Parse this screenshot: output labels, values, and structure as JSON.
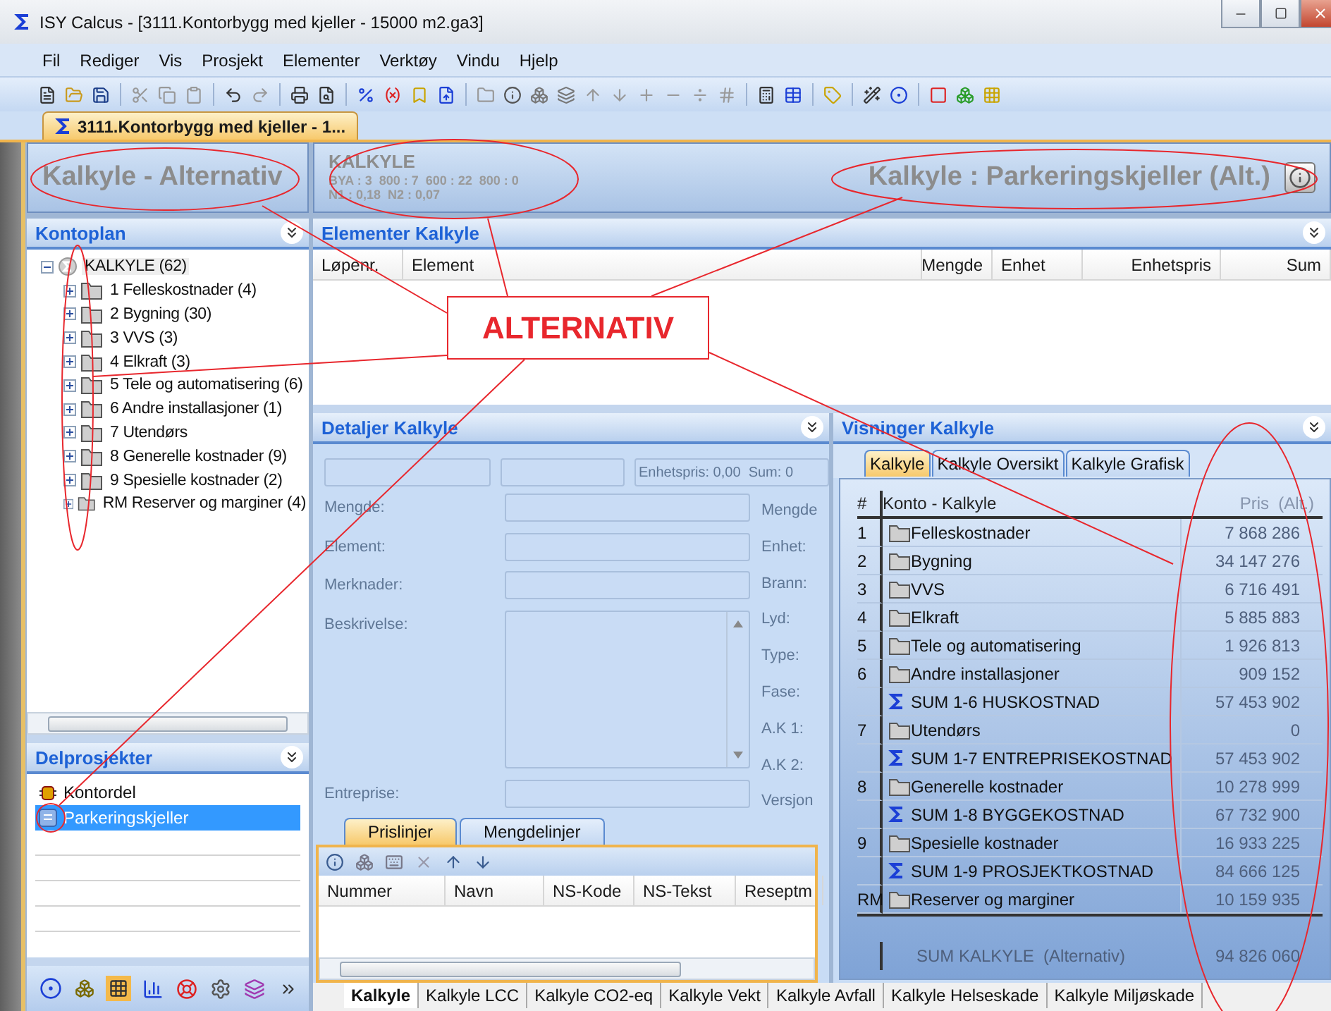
{
  "window": {
    "title": "ISY Calcus - [3111.Kontorbygg med kjeller - 15000 m2.ga3]"
  },
  "menu": [
    {
      "label": "Fil"
    },
    {
      "label": "Rediger"
    },
    {
      "label": "Vis"
    },
    {
      "label": "Prosjekt"
    },
    {
      "label": "Elementer"
    },
    {
      "label": "Verktøy"
    },
    {
      "label": "Vindu"
    },
    {
      "label": "Hjelp"
    }
  ],
  "document_tab": {
    "label": "3111.Kontorbygg med kjeller - 1...",
    "selected": true
  },
  "mode_title": "Kalkyle - Alternativ",
  "kontoplan": {
    "title": "Kontoplan",
    "tree": {
      "label": "KALKYLE (62)",
      "expanded": true,
      "children": [
        {
          "label": "1 Felleskostnader (4)",
          "expanded": false
        },
        {
          "label": "2 Bygning (30)",
          "expanded": false
        },
        {
          "label": "3 VVS (3)",
          "expanded": false
        },
        {
          "label": "4 Elkraft (3)",
          "expanded": false
        },
        {
          "label": "5 Tele og automatisering (6)",
          "expanded": false
        },
        {
          "label": "6 Andre installasjoner (1)",
          "expanded": false
        },
        {
          "label": "7 Utendørs",
          "expanded": false
        },
        {
          "label": "8 Generelle kostnader (9)",
          "expanded": false
        },
        {
          "label": "9 Spesielle kostnader (2)",
          "expanded": false
        },
        {
          "label": "RM Reserver og marginer (4)",
          "expanded": false
        }
      ]
    }
  },
  "delprosjekter": {
    "title": "Delprosjekter",
    "items": [
      {
        "label": "Kontordel",
        "kind": "box",
        "selected": false
      },
      {
        "label": "Parkeringskjeller",
        "kind": "page",
        "selected": true
      }
    ]
  },
  "summary": {
    "heading": "KALKYLE",
    "line_1": "BYA : 3  800 : 7  600 : 22  800 : 0",
    "line_2": "N1 : 0,18  N2 : 0,07",
    "title": "Kalkyle : Parkeringskjeller (Alt.)"
  },
  "elementer": {
    "title": "Elementer Kalkyle",
    "columns": [
      {
        "label": "Løpenr."
      },
      {
        "label": "Element"
      },
      {
        "label": "Mengde"
      },
      {
        "label": "Enhet"
      },
      {
        "label": "Enhetspris"
      },
      {
        "label": "Sum"
      }
    ]
  },
  "detaljer": {
    "title": "Detaljer Kalkyle",
    "disabled": true,
    "totals": "Enhetspris: 0,00  Sum: 0",
    "left_labels": [
      "Mengde:",
      "Element:",
      "Merknader:",
      "Beskrivelse:",
      "Entreprise:"
    ],
    "right_labels": [
      "Mengde",
      "Enhet:",
      "Brann:",
      "Lyd:",
      "Type:",
      "Fase:",
      "A.K 1:",
      "A.K 2:",
      "Versjon"
    ],
    "subtabs": [
      {
        "label": "Prislinjer",
        "selected": true
      },
      {
        "label": "Mengdelinjer",
        "selected": false
      }
    ],
    "columns": [
      "Nummer",
      "Navn",
      "NS-Kode",
      "NS-Tekst",
      "Reseptm"
    ]
  },
  "visninger": {
    "title": "Visninger Kalkyle",
    "tabs": [
      {
        "label": "Kalkyle",
        "selected": true
      },
      {
        "label": "Kalkyle Oversikt",
        "selected": false
      },
      {
        "label": "Kalkyle Grafisk",
        "selected": false
      }
    ],
    "columns": [
      "#",
      "Konto - Kalkyle",
      "Pris  (Alt.)"
    ],
    "rows": [
      {
        "number": "1",
        "kind": "folder",
        "label": "Felleskostnader",
        "price": "7 868 286"
      },
      {
        "number": "2",
        "kind": "folder",
        "label": "Bygning",
        "price": "34 147 276"
      },
      {
        "number": "3",
        "kind": "folder",
        "label": "VVS",
        "price": "6 716 491"
      },
      {
        "number": "4",
        "kind": "folder",
        "label": "Elkraft",
        "price": "5 885 883"
      },
      {
        "number": "5",
        "kind": "folder",
        "label": "Tele og automatisering",
        "price": "1 926 813"
      },
      {
        "number": "6",
        "kind": "folder",
        "label": "Andre installasjoner",
        "price": "909 152"
      },
      {
        "kind": "sum",
        "label": "SUM 1-6 HUSKOSTNAD",
        "price": "57 453 902"
      },
      {
        "number": "7",
        "kind": "folder",
        "label": "Utendørs",
        "price": "0"
      },
      {
        "kind": "sum",
        "label": "SUM 1-7 ENTREPRISEKOSTNAD",
        "price": "57 453 902"
      },
      {
        "number": "8",
        "kind": "folder",
        "label": "Generelle kostnader",
        "price": "10 278 999"
      },
      {
        "kind": "sum",
        "label": "SUM 1-8 BYGGEKOSTNAD",
        "price": "67 732 900"
      },
      {
        "number": "9",
        "kind": "folder",
        "label": "Spesielle kostnader",
        "price": "16 933 225"
      },
      {
        "kind": "sum",
        "label": "SUM 1-9 PROSJEKTKOSTNAD",
        "price": "84 666 125"
      },
      {
        "number": "RM",
        "kind": "folder",
        "label": "Reserver og marginer",
        "price": "10 159 935"
      }
    ],
    "total": {
      "label": "SUM KALKYLE  (Alternativ)",
      "price": "94 826 060"
    }
  },
  "bottom_tabs": [
    {
      "label": "Kalkyle",
      "selected": true
    },
    {
      "label": "Kalkyle LCC",
      "selected": false
    },
    {
      "label": "Kalkyle CO2-eq",
      "selected": false
    },
    {
      "label": "Kalkyle Vekt",
      "selected": false
    },
    {
      "label": "Kalkyle Avfall",
      "selected": false
    },
    {
      "label": "Kalkyle Helseskade",
      "selected": false
    },
    {
      "label": "Kalkyle Miljøskade",
      "selected": false
    }
  ],
  "annotation": {
    "label": "ALTERNATIV"
  }
}
